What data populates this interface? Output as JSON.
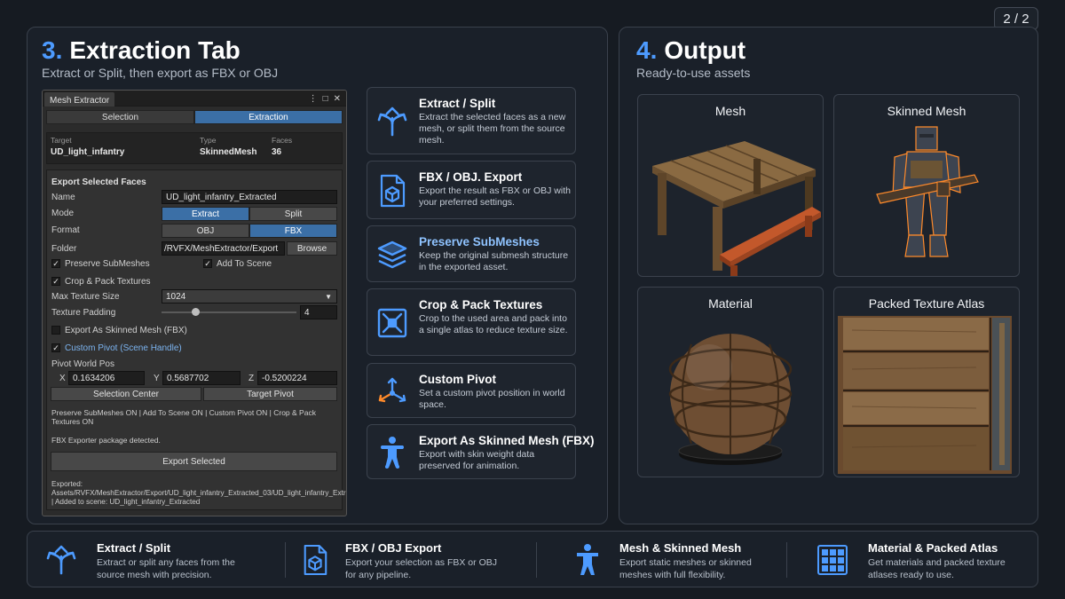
{
  "page_counter": "2 / 2",
  "extraction": {
    "number": "3.",
    "title": "Extraction Tab",
    "subtitle": "Extract or Split, then export as FBX or OBJ"
  },
  "output": {
    "number": "4.",
    "title": "Output",
    "subtitle": "Ready-to-use assets",
    "tiles": [
      {
        "title": "Mesh"
      },
      {
        "title": "Skinned Mesh"
      },
      {
        "title": "Material"
      },
      {
        "title": "Packed Texture Atlas"
      }
    ]
  },
  "unity": {
    "window_tab": "Mesh Extractor",
    "toolbar": [
      "Selection",
      "Extraction"
    ],
    "info": {
      "target_label": "Target",
      "target_value": "UD_light_infantry",
      "type_label": "Type",
      "type_value": "SkinnedMesh",
      "faces_label": "Faces",
      "faces_value": "36"
    },
    "section_header": "Export Selected Faces",
    "name_label": "Name",
    "name_value": "UD_light_infantry_Extracted",
    "mode_label": "Mode",
    "mode_options": [
      "Extract",
      "Split"
    ],
    "format_label": "Format",
    "format_options": [
      "OBJ",
      "FBX"
    ],
    "folder_label": "Folder",
    "folder_value": "/RVFX/MeshExtractor/Export",
    "browse_label": "Browse",
    "preserve_submeshes": "Preserve SubMeshes",
    "add_to_scene": "Add To Scene",
    "crop_pack": "Crop & Pack Textures",
    "max_texture_label": "Max Texture Size",
    "max_texture_value": "1024",
    "padding_label": "Texture Padding",
    "padding_value": "4",
    "padding_fraction": 0.25,
    "export_skinned": "Export As Skinned Mesh (FBX)",
    "custom_pivot": "Custom Pivot (Scene Handle)",
    "pivot_label": "Pivot World Pos",
    "pivot_x_label": "X",
    "pivot_x": "0.1634206",
    "pivot_y_label": "Y",
    "pivot_y": "0.5687702",
    "pivot_z_label": "Z",
    "pivot_z": "-0.5200224",
    "selection_center": "Selection Center",
    "target_pivot": "Target Pivot",
    "status_flags": "Preserve SubMeshes ON | Add To Scene ON | Custom Pivot ON | Crop & Pack Textures ON",
    "fbx_detected": "FBX Exporter package detected.",
    "export_button": "Export Selected",
    "exported_log": "Exported: Assets/RVFX/MeshExtractor/Export/UD_light_infantry_Extracted_03/UD_light_infantry_Extracted.fbx | Added to scene: UD_light_infantry_Extracted"
  },
  "features": [
    {
      "title": "Extract / Split",
      "desc": "Extract the selected faces as a new mesh, or split them from the source mesh.",
      "icon": "split-arrows-icon"
    },
    {
      "title": "FBX / OBJ. Export",
      "desc": "Export the result as FBX or OBJ with your preferred settings.",
      "icon": "export-file-icon"
    },
    {
      "title": "Preserve SubMeshes",
      "desc": "Keep the original submesh structure in the exported asset.",
      "icon": "layers-icon"
    },
    {
      "title": "Crop & Pack Textures",
      "desc": "Crop to the used area and pack into a single atlas to reduce texture size.",
      "icon": "crop-pack-icon"
    },
    {
      "title": "Custom Pivot",
      "desc": "Set a custom pivot position in world space.",
      "icon": "pivot-axes-icon"
    },
    {
      "title": "Export As Skinned Mesh (FBX)",
      "desc": "Export with skin weight data preserved for animation.",
      "icon": "humanoid-icon"
    }
  ],
  "bottom": [
    {
      "title": "Extract / Split",
      "desc": "Extract or split any faces from the source mesh with precision.",
      "icon": "split-arrows-icon"
    },
    {
      "title": "FBX / OBJ Export",
      "desc": "Export your selection as FBX or OBJ for any pipeline.",
      "icon": "export-file-icon"
    },
    {
      "title": "Mesh & Skinned Mesh",
      "desc": "Export static meshes or skinned meshes with full flexibility.",
      "icon": "humanoid-icon"
    },
    {
      "title": "Material & Packed Atlas",
      "desc": "Get materials and packed texture atlases ready to use.",
      "icon": "atlas-grid-icon"
    }
  ],
  "colors": {
    "accent": "#4d9bff",
    "unity_selected": "#3b6fa6"
  }
}
